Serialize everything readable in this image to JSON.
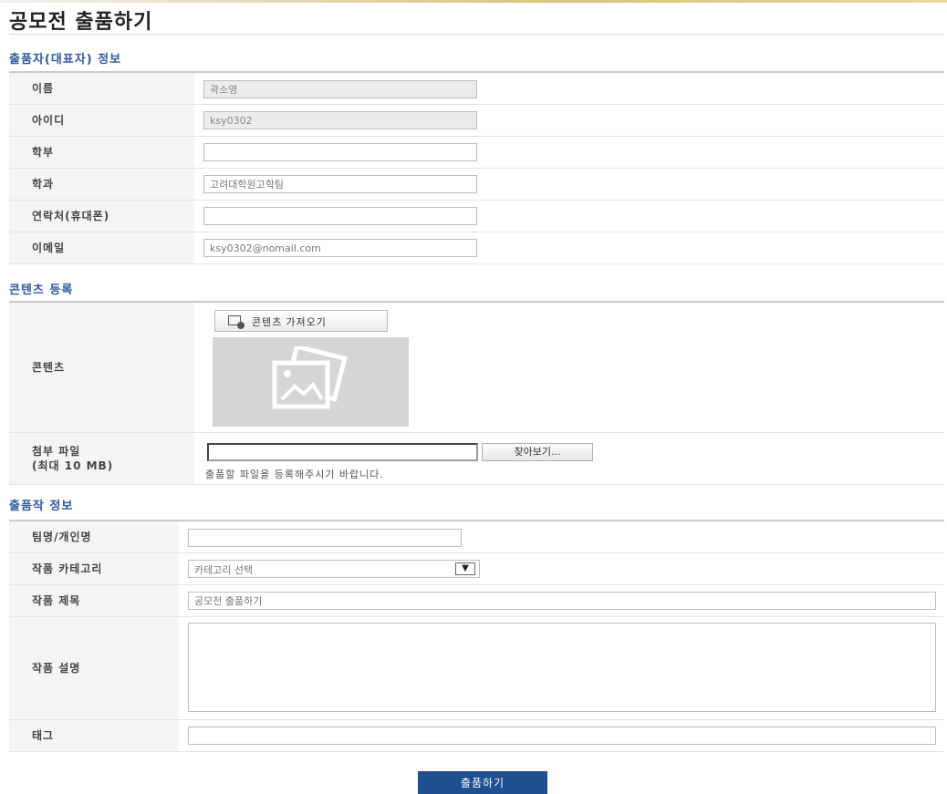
{
  "page": {
    "title": "공모전 출품하기"
  },
  "sections": {
    "author": {
      "title": "출품자(대표자) 정보"
    },
    "content": {
      "title": "콘텐츠 등록"
    },
    "work": {
      "title": "출품작 정보"
    }
  },
  "author": {
    "name": {
      "label": "이름",
      "value": "곽소영"
    },
    "id": {
      "label": "아이디",
      "value": "ksy0302"
    },
    "faculty": {
      "label": "학부",
      "value": ""
    },
    "department": {
      "label": "학과",
      "value": "고려대학원고학팀"
    },
    "phone": {
      "label": "연락처(휴대폰)",
      "value": ""
    },
    "email": {
      "label": "이메일",
      "value": "ksy0302@nomail.com"
    }
  },
  "content": {
    "label": "콘텐츠",
    "import_button": "콘텐츠 가져오기",
    "thumbnail_icon": "image-placeholder-icon",
    "attachment": {
      "label": "첨부 파일\n(최대 10 MB)",
      "value": "",
      "browse_button": "찾아보기...",
      "help": "출품할 파일을 등록해주시기 바랍니다."
    }
  },
  "work": {
    "team": {
      "label": "팀명/개인명",
      "value": ""
    },
    "category": {
      "label": "작품 카테고리",
      "selected": "카테고리 선택"
    },
    "title": {
      "label": "작품 제목",
      "value": "공모전 출품하기"
    },
    "description": {
      "label": "작품 설명",
      "value": ""
    },
    "tags": {
      "label": "태그",
      "value": ""
    }
  },
  "submit_label": "출품하기",
  "colors": {
    "section_heading": "#2f5a9c",
    "submit_bg": "#1f4f8f",
    "label_bg": "#f4f4f4"
  }
}
